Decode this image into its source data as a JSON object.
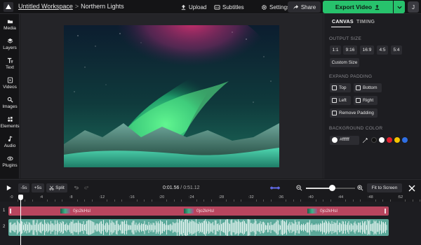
{
  "header": {
    "workspace": "Untitled Workspace",
    "separator": ">",
    "project": "Northern Lights",
    "upload_label": "Upload",
    "subtitles_label": "Subtitles",
    "settings_label": "Settings",
    "share_label": "Share",
    "export_label": "Export Video",
    "avatar_initial": "J"
  },
  "sidebar": {
    "items": [
      {
        "label": "Media",
        "icon": "media-icon"
      },
      {
        "label": "Layers",
        "icon": "layers-icon"
      },
      {
        "label": "Text",
        "icon": "text-icon"
      },
      {
        "label": "Videos",
        "icon": "videos-icon"
      },
      {
        "label": "Images",
        "icon": "images-icon"
      },
      {
        "label": "Elements",
        "icon": "elements-icon"
      },
      {
        "label": "Audio",
        "icon": "audio-icon"
      },
      {
        "label": "Plugins",
        "icon": "plugins-icon"
      }
    ]
  },
  "panel": {
    "tabs": [
      "CANVAS",
      "TIMING"
    ],
    "active_tab": "CANVAS",
    "output_size_label": "OUTPUT SIZE",
    "ratios": [
      "1:1",
      "9:16",
      "16:9",
      "4:5",
      "5:4"
    ],
    "custom_size_label": "Custom Size",
    "expand_padding_label": "EXPAND PADDING",
    "padding_options": [
      "Top",
      "Bottom",
      "Left",
      "Right"
    ],
    "remove_padding_label": "Remove Padding",
    "background_color_label": "BACKGROUND COLOR",
    "background_color_value": "#ffffff",
    "swatches": [
      "#ffffff",
      "#111111",
      "#ffffff",
      "#e0202e",
      "#f5c400",
      "#2f6fe4"
    ]
  },
  "controls": {
    "back_label": "-5s",
    "forward_label": "+5s",
    "split_label": "Split",
    "current_time": "0:01.56",
    "time_separator": " / ",
    "total_time": "0:51.12",
    "fit_label": "Fit to Screen",
    "zoom_level": 0.55
  },
  "timeline": {
    "ticks": [
      ":0",
      ":4",
      ":8",
      ":12",
      ":16",
      ":20",
      ":24",
      ":28",
      ":32",
      ":36",
      ":40",
      ":44",
      ":48",
      ":52"
    ],
    "video_row": "1",
    "audio_row": "2",
    "clip_labels": [
      "0jo2kHsl",
      "0jo2kHsl",
      "0jo2kHsl"
    ],
    "playhead_time": "0:01.56"
  }
}
